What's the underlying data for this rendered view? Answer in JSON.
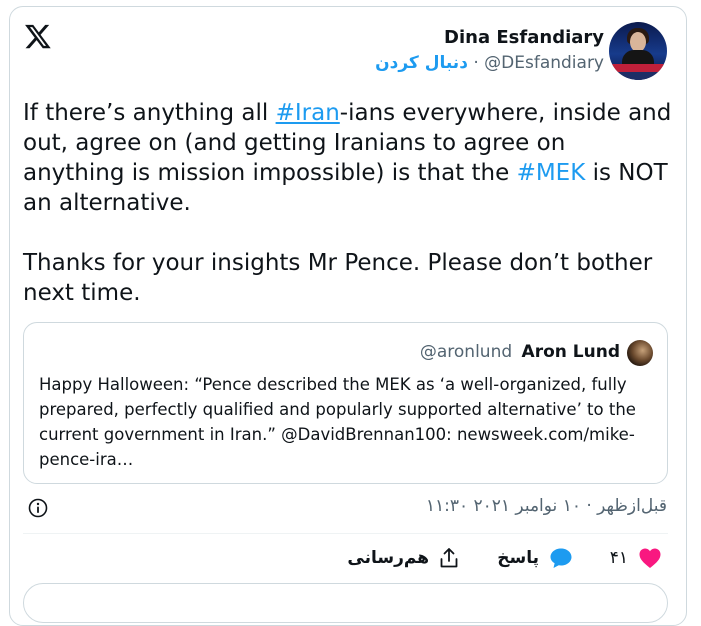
{
  "author": {
    "name": "Dina Esfandiary",
    "handle": "@DEsfandiary",
    "separator": "·",
    "follow_label": "دنبال کردن"
  },
  "tweet": {
    "line_1_before": "If there’s anything all ",
    "hashtag_iran": "#Iran",
    "line_1_after": "-ians everywhere, inside and out, agree on (and getting Iranians to agree on anything is mission impossible) is that the ",
    "hashtag_mek": "#MEK",
    "line_1_end": " is NOT an alternative.",
    "paragraph_2": "Thanks for your insights Mr Pence. Please don’t bother next time."
  },
  "quoted": {
    "name": "Aron Lund",
    "handle": "@aronlund",
    "text": "Happy Halloween: “Pence described the MEK as ‘a well-organized, fully prepared, perfectly qualified and popularly supported alternative’ to the current government in Iran.” @DavidBrennan100: newsweek.com/mike-pence-ira…"
  },
  "timestamp": "۱۱:۳۰ قبل‌ازظهر · ۱۰ نوامبر ۲۰۲۱",
  "actions": {
    "like_count": "۴۱",
    "reply_label": "پاسخ",
    "share_label": "هم‌رسانی"
  },
  "colors": {
    "accent": "#1d9bf0",
    "like": "#f91880",
    "muted": "#536471"
  }
}
